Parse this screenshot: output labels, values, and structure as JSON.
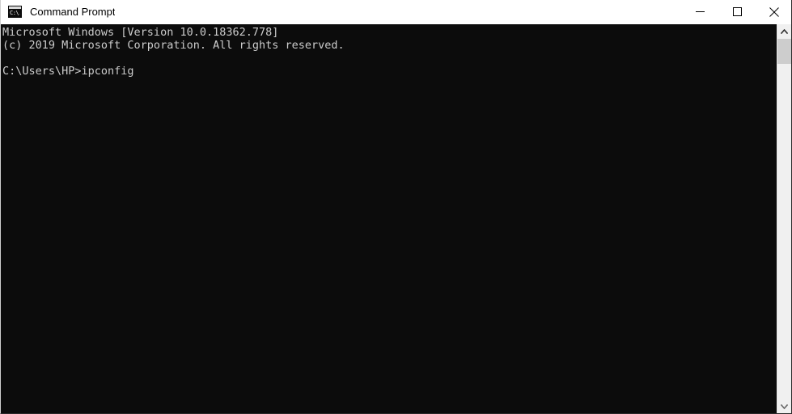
{
  "window": {
    "title": "Command Prompt",
    "app_icon": "command-prompt-icon",
    "icon_glyph": "C:\\.",
    "colors": {
      "titlebar_bg": "#ffffff",
      "titlebar_fg": "#000000",
      "console_bg": "#0c0c0c",
      "console_fg": "#cccccc",
      "scrollbar_track": "#f0f0f0",
      "scrollbar_thumb": "#cdcdcd"
    },
    "controls": [
      {
        "name": "minimize",
        "icon": "minimize-icon",
        "label": "Minimize"
      },
      {
        "name": "maximize",
        "icon": "maximize-icon",
        "label": "Maximize"
      },
      {
        "name": "close",
        "icon": "close-icon",
        "label": "Close"
      }
    ]
  },
  "console": {
    "lines": [
      "Microsoft Windows [Version 10.0.18362.778]",
      "(c) 2019 Microsoft Corporation. All rights reserved.",
      "",
      "C:\\Users\\HP>ipconfig"
    ],
    "text": "Microsoft Windows [Version 10.0.18362.778]\n(c) 2019 Microsoft Corporation. All rights reserved.\n\nC:\\Users\\HP>ipconfig",
    "os_name": "Microsoft Windows",
    "os_version": "10.0.18362.778",
    "copyright": "(c) 2019 Microsoft Corporation. All rights reserved.",
    "prompt": "C:\\Users\\HP>",
    "command": "ipconfig"
  },
  "scrollbar": {
    "up_arrow": "chevron-up-icon",
    "down_arrow": "chevron-down-icon"
  }
}
